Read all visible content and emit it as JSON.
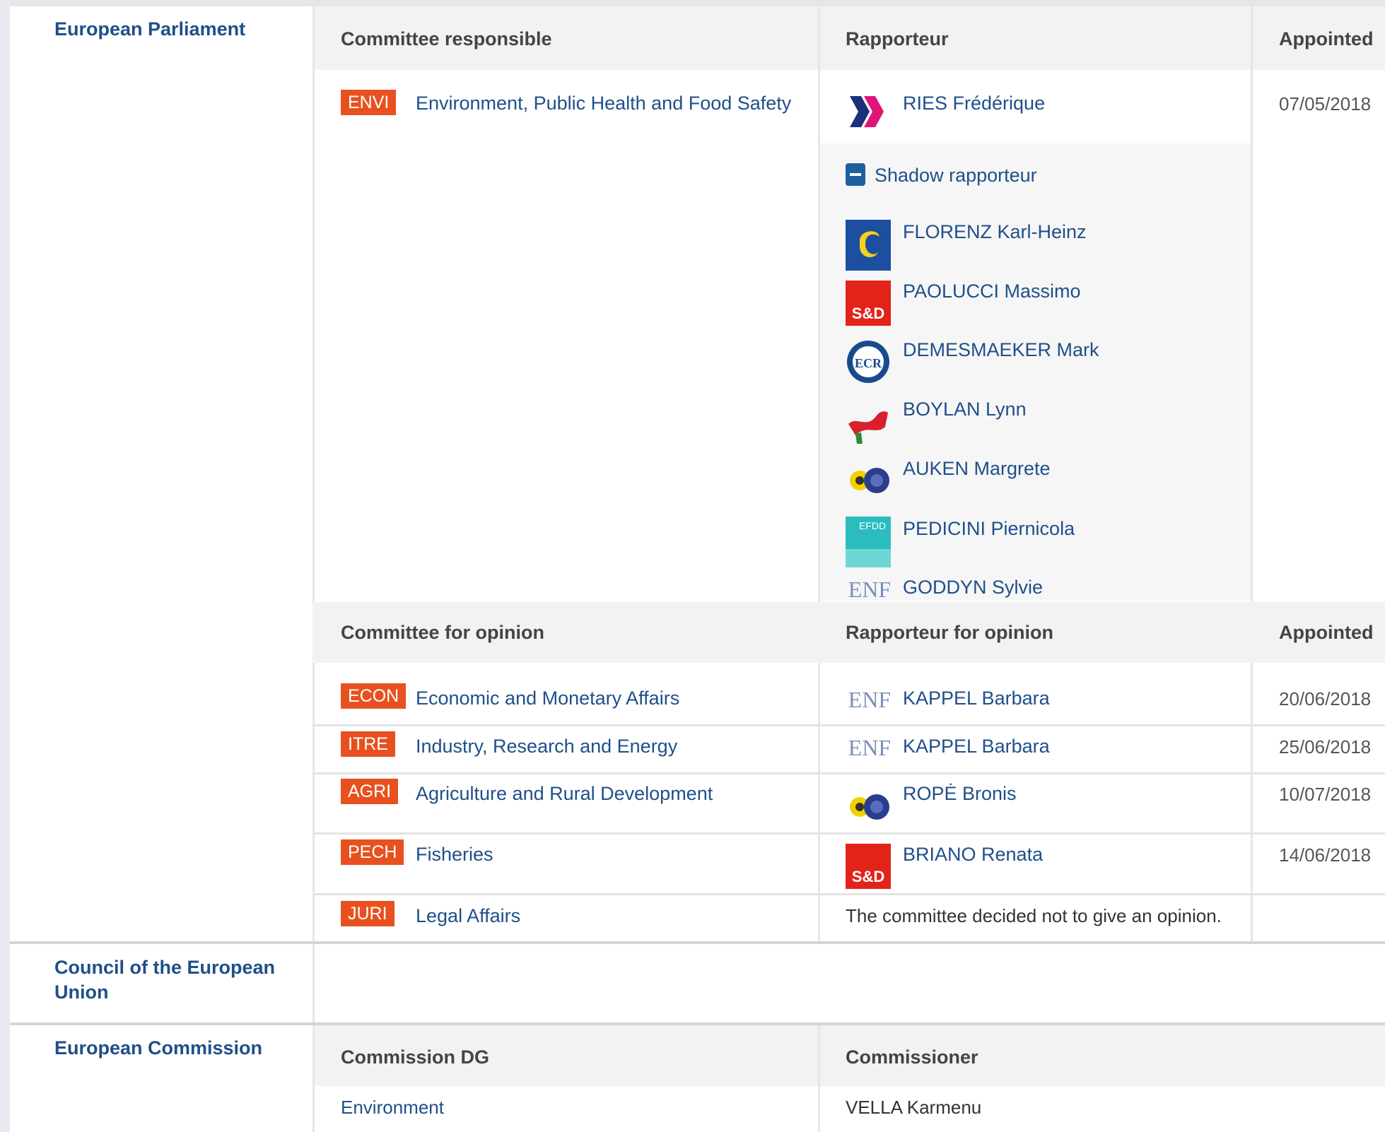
{
  "institutions": {
    "parliament": "European Parliament",
    "council": "Council of the European Union",
    "commission": "European Commission"
  },
  "responsible": {
    "headers": {
      "committee": "Committee responsible",
      "rapporteur": "Rapporteur",
      "appointed": "Appointed"
    },
    "committee_code": "ENVI",
    "committee_name": "Environment, Public Health and Food Safety",
    "rapporteur": {
      "name": "RIES Frédérique",
      "group_icon": "renew-group-icon"
    },
    "appointed": "07/05/2018",
    "shadow_label": "Shadow rapporteur",
    "shadows": [
      {
        "name": "FLORENZ Karl-Heinz",
        "group_icon": "epp-group-icon"
      },
      {
        "name": "PAOLUCCI Massimo",
        "group_icon": "sd-group-icon",
        "logo_text": "S&D"
      },
      {
        "name": "DEMESMAEKER Mark",
        "group_icon": "ecr-group-icon",
        "logo_text": "ECR"
      },
      {
        "name": "BOYLAN Lynn",
        "group_icon": "gue-group-icon"
      },
      {
        "name": "AUKEN Margrete",
        "group_icon": "greens-group-icon"
      },
      {
        "name": "PEDICINI Piernicola",
        "group_icon": "efdd-group-icon",
        "logo_text": "EFDD"
      },
      {
        "name": "GODDYN Sylvie",
        "group_icon": "enf-group-icon",
        "logo_text": "ENF"
      }
    ]
  },
  "opinion": {
    "headers": {
      "committee": "Committee for opinion",
      "rapporteur": "Rapporteur for opinion",
      "appointed": "Appointed"
    },
    "rows": [
      {
        "code": "ECON",
        "name": "Economic and Monetary Affairs",
        "rapporteur": "KAPPEL Barbara",
        "group_icon": "enf-group-icon",
        "logo_text": "ENF",
        "appointed": "20/06/2018"
      },
      {
        "code": "ITRE",
        "name": "Industry, Research and Energy",
        "rapporteur": "KAPPEL Barbara",
        "group_icon": "enf-group-icon",
        "logo_text": "ENF",
        "appointed": "25/06/2018"
      },
      {
        "code": "AGRI",
        "name": "Agriculture and Rural Development",
        "rapporteur": "ROPĖ Bronis",
        "group_icon": "greens-group-icon",
        "appointed": "10/07/2018"
      },
      {
        "code": "PECH",
        "name": "Fisheries",
        "rapporteur": "BRIANO Renata",
        "group_icon": "sd-group-icon",
        "logo_text": "S&D",
        "appointed": "14/06/2018"
      },
      {
        "code": "JURI",
        "name": "Legal Affairs",
        "note": "The committee decided not to give an opinion."
      }
    ]
  },
  "commission": {
    "headers": {
      "dg": "Commission DG",
      "commissioner": "Commissioner"
    },
    "dg": "Environment",
    "commissioner": "VELLA Karmenu"
  },
  "colors": {
    "badge": "#e8511f",
    "link": "#1f4f8a",
    "header_bg": "#f2f2f2"
  }
}
